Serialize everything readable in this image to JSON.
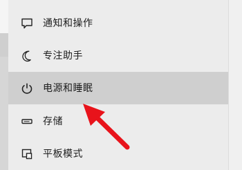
{
  "menu": {
    "items": [
      {
        "label": "通知和操作",
        "icon": "message-icon"
      },
      {
        "label": "专注助手",
        "icon": "moon-icon"
      },
      {
        "label": "电源和睡眠",
        "icon": "power-icon",
        "selected": true
      },
      {
        "label": "存储",
        "icon": "storage-icon"
      },
      {
        "label": "平板模式",
        "icon": "tablet-mode-icon"
      }
    ]
  },
  "colors": {
    "selected_bg": "#cfcfcf",
    "arrow": "#e8131b"
  }
}
